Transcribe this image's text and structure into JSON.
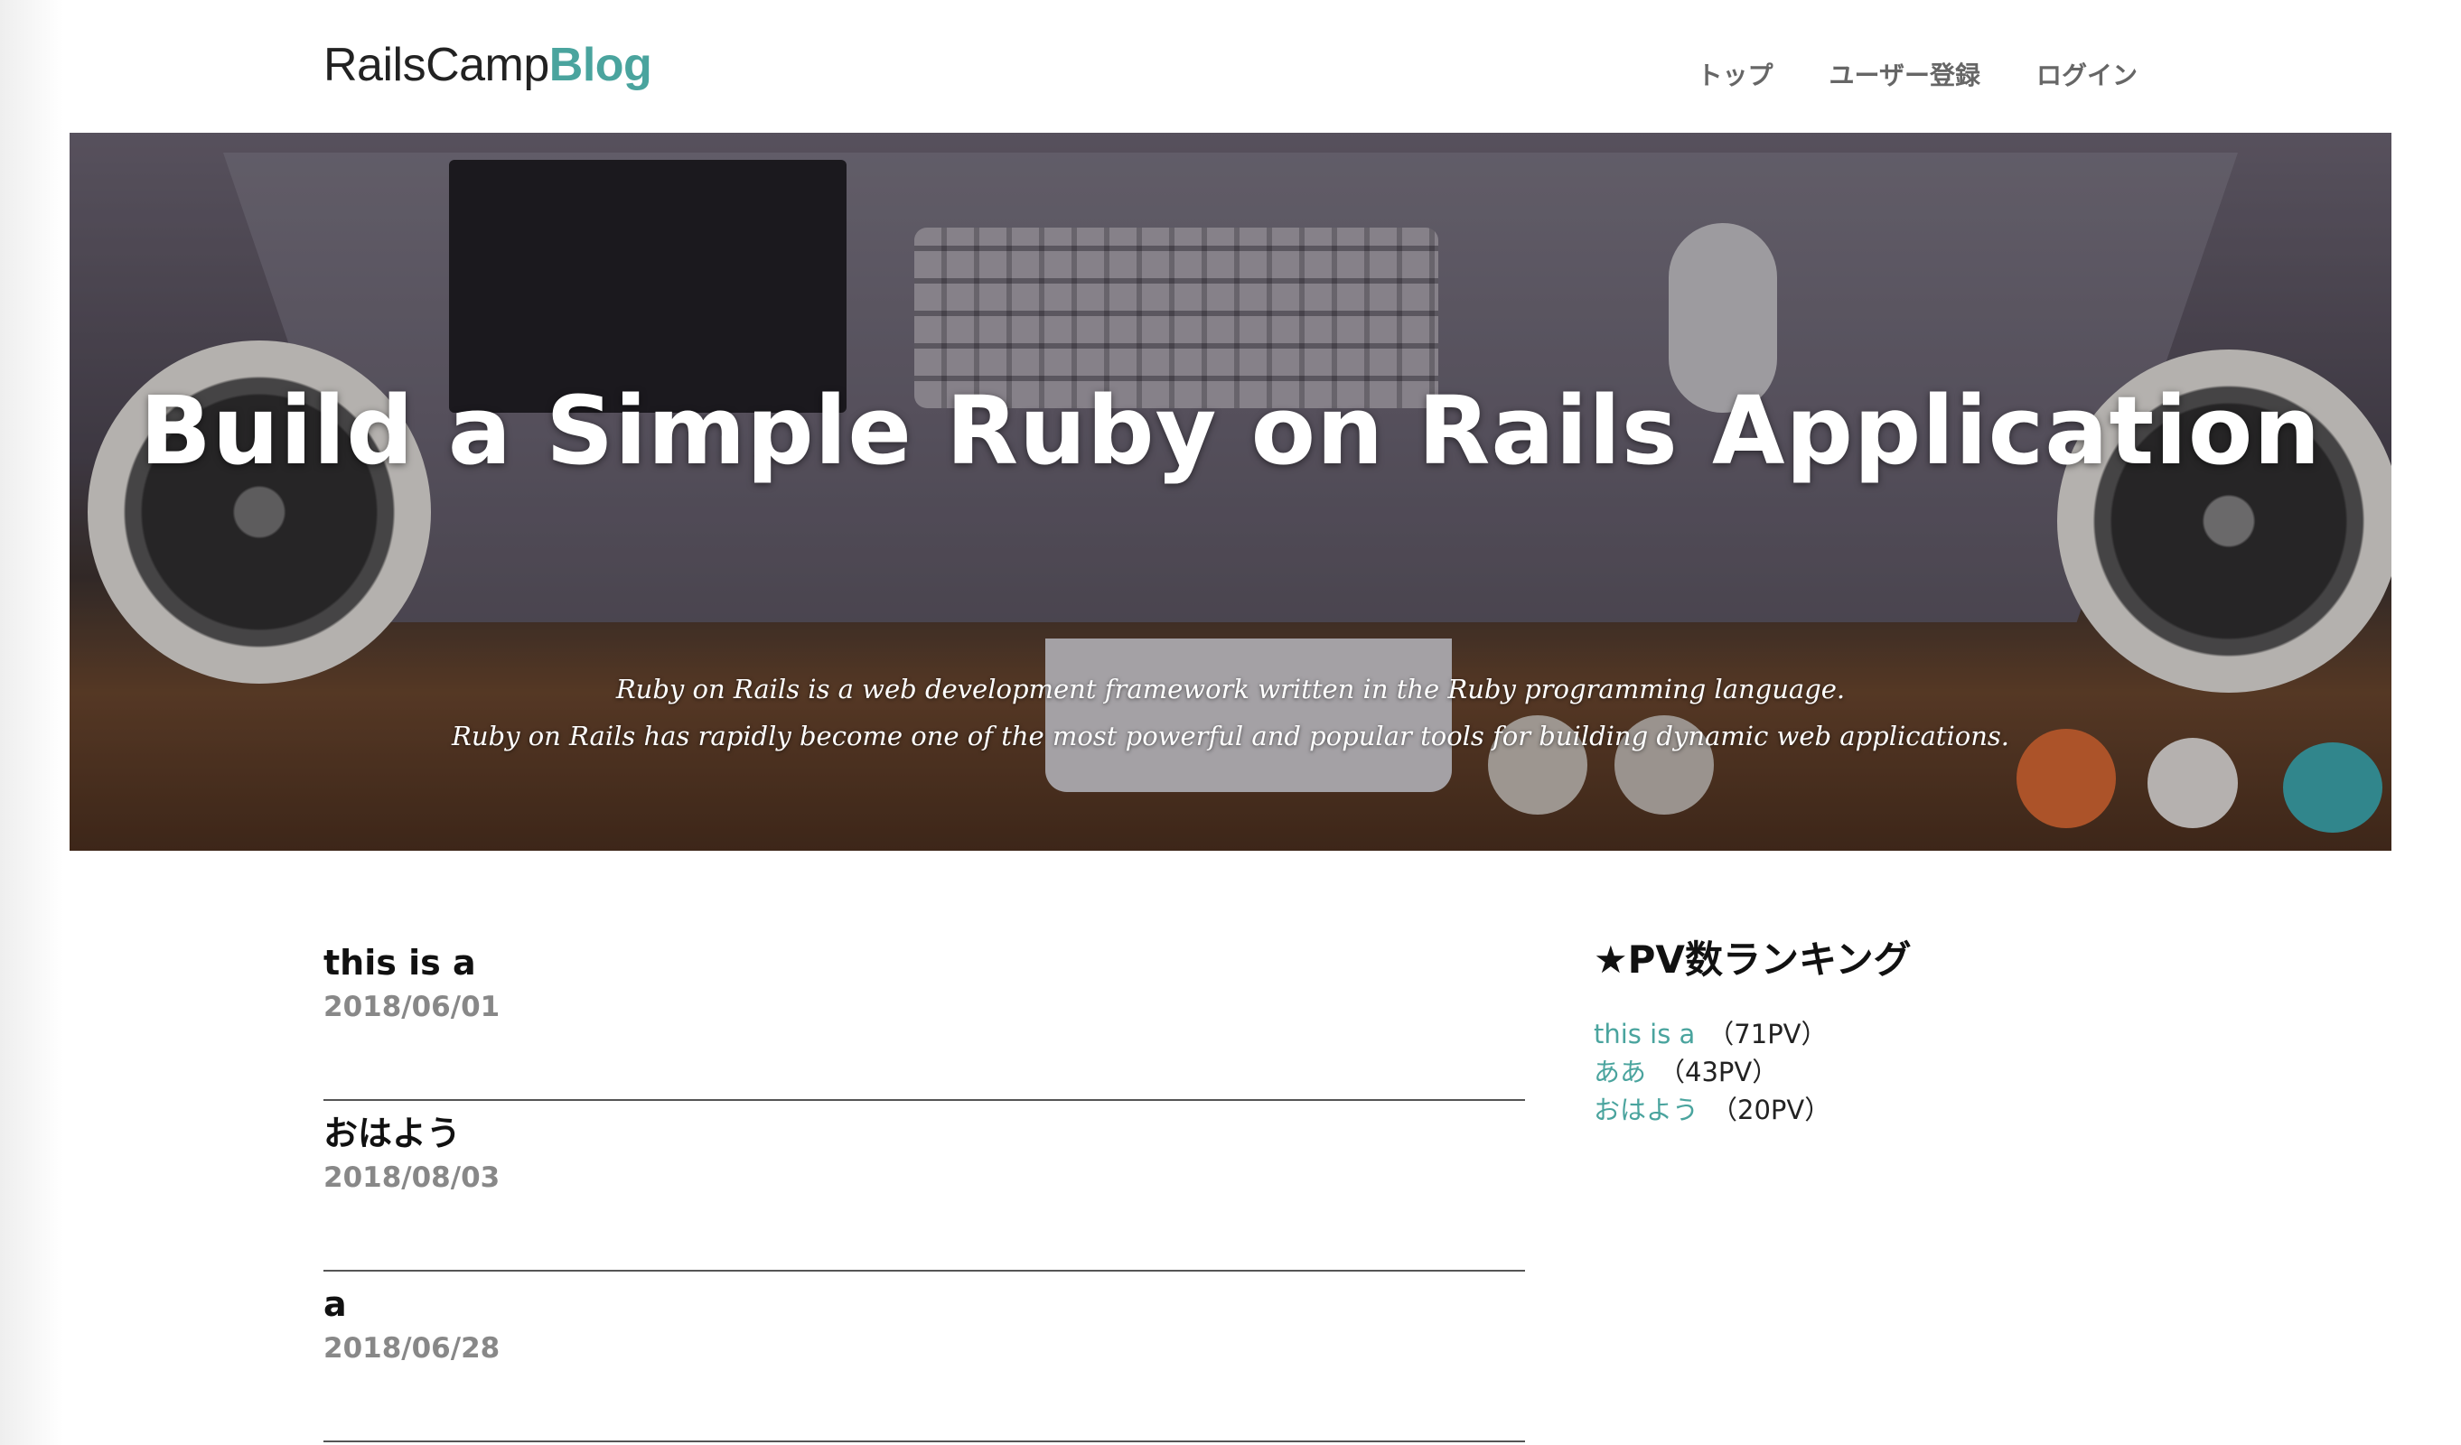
{
  "brand": {
    "name": "RailsCamp",
    "accent": "Blog",
    "accent_color": "#4aa49e"
  },
  "nav": [
    {
      "label": "トップ"
    },
    {
      "label": "ユーザー登録"
    },
    {
      "label": "ログイン"
    }
  ],
  "hero": {
    "title": "Build a Simple Ruby on Rails Application",
    "subtitle_line1": "Ruby on Rails is a web development framework written in the Ruby programming language.",
    "subtitle_line2": "Ruby on Rails has rapidly become one of the most powerful and popular tools for building dynamic web applications."
  },
  "posts": [
    {
      "title": "this is a",
      "date": "2018/06/01"
    },
    {
      "title": "おはよう",
      "date": "2018/08/03"
    },
    {
      "title": "a",
      "date": "2018/06/28"
    }
  ],
  "ranking": {
    "title": "★PV数ランキング",
    "items": [
      {
        "title": "this is a",
        "pv": "（71PV）"
      },
      {
        "title": "ああ",
        "pv": "（43PV）"
      },
      {
        "title": "おはよう",
        "pv": "（20PV）"
      }
    ]
  }
}
